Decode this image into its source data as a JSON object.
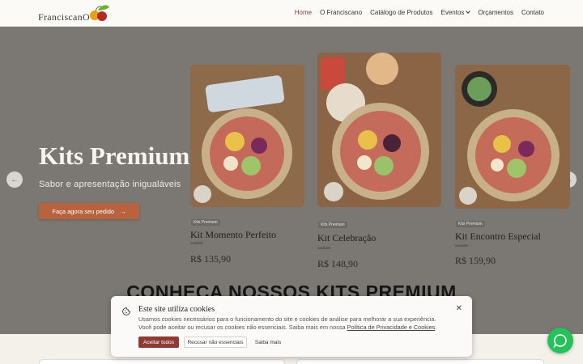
{
  "brand": {
    "logo_text": "FranciscanO"
  },
  "nav": [
    {
      "label": "Home",
      "active": true
    },
    {
      "label": "O Franciscano"
    },
    {
      "label": "Catálogo de Produtos"
    },
    {
      "label": "Eventos",
      "has_dropdown": true
    },
    {
      "label": "Orçamentos"
    },
    {
      "label": "Contato"
    }
  ],
  "hero": {
    "title": "Kits Premium",
    "subtitle": "Sabor e apresentação inigualáveis",
    "cta_label": "Faça agora seu pedido",
    "prev_icon": "arrow-left-icon",
    "next_icon": "arrow-right-icon"
  },
  "kits": [
    {
      "tag": "Kits Premium",
      "name": "Kit Momento Perfeito",
      "unit": "unidade",
      "price": "R$ 135,90"
    },
    {
      "tag": "Kits Premium",
      "name": "Kit Celebração",
      "unit": "unidade",
      "price": "R$ 148,90"
    },
    {
      "tag": "Kits Premium",
      "name": "Kit Encontro Especial",
      "unit": "unidade",
      "price": "R$ 159,90"
    }
  ],
  "section": {
    "heading": "CONHEÇA NOSSOS KITS PREMIUM"
  },
  "cookie": {
    "title": "Este site utiliza cookies",
    "text_1": "Usamos cookies necessários para o funcionamento do site e cookies de análise para melhorar a sua experiência.",
    "text_2": "Você pode aceitar ou recusar os cookies não essenciais. Saiba mais em nossa",
    "policy_link": "Política de Privacidade e Cookies",
    "accept_label": "Aceitar todos",
    "refuse_label": "Recusar não essenciais",
    "more_label": "Saiba mais"
  },
  "colors": {
    "accent": "#8e3b36",
    "cta": "#b8633e",
    "whatsapp": "#25c15a"
  }
}
